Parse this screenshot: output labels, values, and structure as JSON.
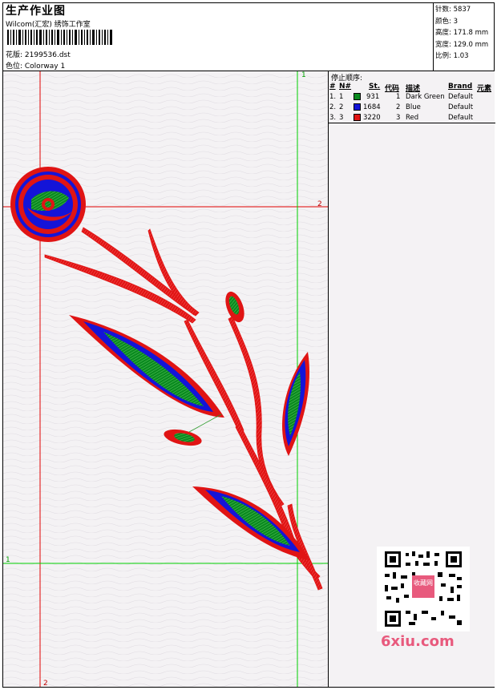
{
  "header": {
    "title": "生产作业图",
    "company": "Wilcom(汇宏) 绣饰工作室",
    "design": "花版: 2199536.dst",
    "colorway": "色位: Colorway 1"
  },
  "stats": {
    "stitches_label": "针数:",
    "stitches": "5837",
    "colors_label": "颜色:",
    "colors": "3",
    "height_label": "高度:",
    "height": "171.8 mm",
    "width_label": "宽度:",
    "width": "129.0 mm",
    "scale_label": "比例:",
    "scale": "1.03"
  },
  "stop_sequence": {
    "title": "停止顺序:",
    "headers": {
      "hash": "#",
      "n": "N#",
      "st": "St.",
      "code": "代码",
      "desc": "描述",
      "brand": "Brand",
      "element": "元素"
    },
    "rows": [
      {
        "hash": "1.",
        "n": "1",
        "color": "#0a8a1f",
        "st": "931",
        "code": "1",
        "desc": "Dark Green",
        "brand": "Default"
      },
      {
        "hash": "2.",
        "n": "2",
        "color": "#1414d8",
        "st": "1684",
        "code": "2",
        "desc": "Blue",
        "brand": "Default"
      },
      {
        "hash": "3.",
        "n": "3",
        "color": "#e01414",
        "st": "3220",
        "code": "3",
        "desc": "Red",
        "brand": "Default"
      }
    ]
  },
  "guides": {
    "v1": "1",
    "h2": "2",
    "h1": "1",
    "v2": "2"
  },
  "watermark": {
    "site": "6xiu.com",
    "badge": "收藏网"
  },
  "colors": {
    "red": "#e01414",
    "blue": "#1414d8",
    "green": "#0a8a1f",
    "guide_red": "#e00000",
    "guide_green": "#00d000"
  }
}
